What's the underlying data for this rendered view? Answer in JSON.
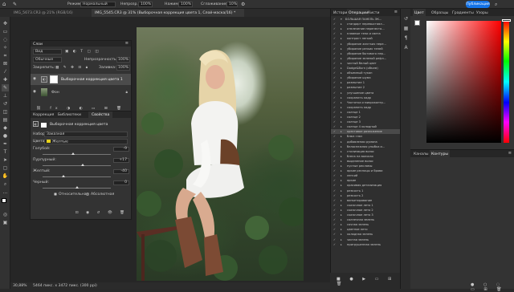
{
  "optionsbar": {
    "items": [
      "Режим:",
      "Нормальный",
      "Непрозр.:",
      "100%",
      "Нажим:",
      "100%",
      "Сглаживание:",
      "10%"
    ],
    "share_button": "Публикация"
  },
  "doc_tabs": [
    {
      "label": "IMG_5673.CR3 @ 21% (RGB/16)",
      "active": false
    },
    {
      "label": "IMG_5545.CR3 @ 31% (Выборочная коррекция цвета 1, Слой-маска/16) *",
      "active": true
    }
  ],
  "layers_panel": {
    "title": "Слои",
    "kind": "Вид",
    "blend_mode": "Обычные",
    "opacity_label": "Непрозрачность:",
    "opacity_value": "100%",
    "lock_label": "Закрепить:",
    "fill_label": "Заливка:",
    "fill_value": "100%",
    "layers": [
      {
        "name": "Выборочная коррекция цвета 1"
      },
      {
        "name": "Фон"
      }
    ]
  },
  "properties_panel": {
    "tabs": [
      "Коррекция",
      "Библиотеки",
      "Свойства"
    ],
    "adjustment_title": "Выборочная коррекция цвета",
    "preset_label": "Набор:",
    "preset_value": "Заказная",
    "colors_label": "Цвета:",
    "colors_value": "Желтые",
    "sliders": [
      {
        "label": "Голубой:",
        "value": "-9",
        "level": 0.45
      },
      {
        "label": "Пурпурный:",
        "value": "+17",
        "level": 0.59
      },
      {
        "label": "Желтый:",
        "value": "-40",
        "level": 0.3
      },
      {
        "label": "Черный:",
        "value": "0",
        "level": 0.5
      }
    ],
    "method_relative": "Относительная",
    "method_absolute": "Абсолютная"
  },
  "actions_panel": {
    "tabs": [
      "История",
      "Операции",
      "Кисти"
    ],
    "items": [
      "БОЛЬШАЯ ПАНЕЛЬ ЭК...",
      "стандарт перевыставл...",
      "отвлечение перепеста...",
      "плавные тени и света",
      "контраст легкий",
      "убирание жестких пере...",
      "убирание резких теней",
      "убирание бытового пер...",
      "убирание зеленой рефл...",
      "чистый белый цвет",
      "Dodge&Burn (объем)",
      "объемный тукан",
      "убирание шума",
      "размытие 1",
      "размытие 2",
      "улучшение цвета",
      "сохранить кадр",
      "Частотка и микроконтр...",
      "сохранить кадр",
      "солнце 1",
      "солнце 2",
      "солнце 3",
      "солнце 4 холодный",
      "крестовое разложение",
      "блюз глаз",
      "добавлении румяна",
      "белоснежная улыбка и...",
      "стилизация волос",
      "блеск на волосах",
      "выделение волос",
      "пустые рекламы",
      "яркие ресницы и брови",
      "легкий",
      "яркие",
      "красивая детализация",
      "резкость 1",
      "резкость 2",
      "виньетирование",
      "сказочное лето 1",
      "сказочное лето 2",
      "сказочное лето 3",
      "солнечная зелень",
      "сочная зелень",
      "цветное лето",
      "холодная зелень",
      "чистая зелень",
      "пригрушенная зелень"
    ]
  },
  "color_panel": {
    "tabs": [
      "Цвет",
      "Образцы",
      "Градиенты",
      "Узоры"
    ],
    "picked_hue": "#ff0000"
  },
  "library_panel": {
    "tabs": [
      "Каналы",
      "Контуры"
    ]
  },
  "statusbar": {
    "zoom": "30,88%",
    "docinfo": "5464 пикс. x 3472 пикс. (300 ppi)"
  }
}
